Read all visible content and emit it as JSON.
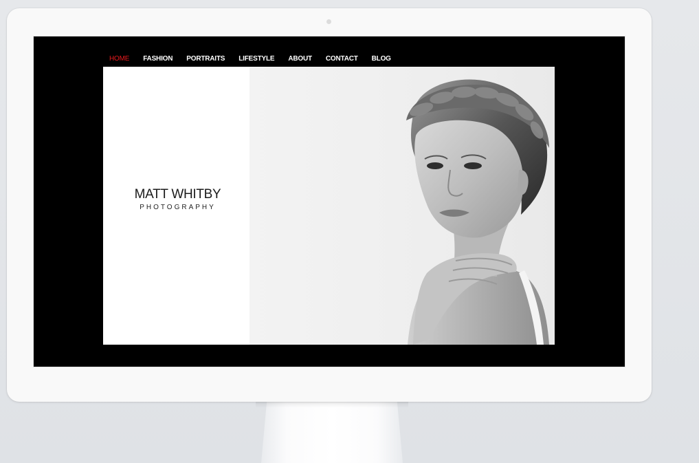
{
  "nav": {
    "items": [
      {
        "label": "HOME",
        "active": true
      },
      {
        "label": "FASHION",
        "active": false
      },
      {
        "label": "PORTRAITS",
        "active": false
      },
      {
        "label": "LIFESTYLE",
        "active": false
      },
      {
        "label": "ABOUT",
        "active": false
      },
      {
        "label": "CONTACT",
        "active": false
      },
      {
        "label": "BLOG",
        "active": false
      }
    ],
    "active_color": "#e8191c"
  },
  "brand": {
    "name": "MATT WHITBY",
    "subtitle": "PHOTOGRAPHY"
  },
  "hero": {
    "image": "black-and-white-portrait-woman-braided-hair"
  },
  "colors": {
    "screen_background": "#000000",
    "content_background": "#ffffff",
    "nav_text": "#ffffff"
  }
}
